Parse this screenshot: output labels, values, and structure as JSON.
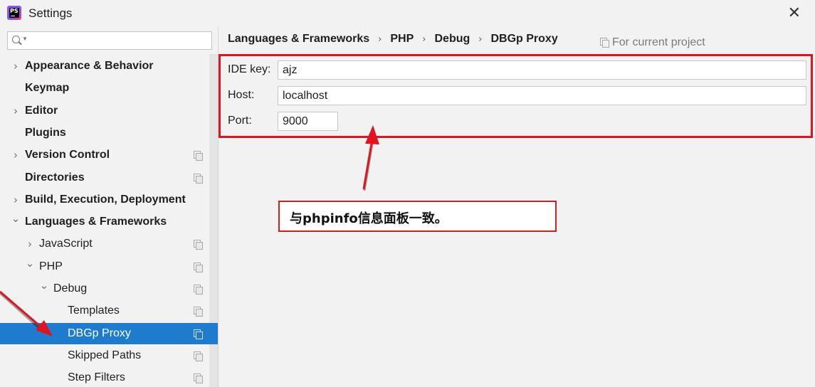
{
  "window": {
    "title": "Settings",
    "close_glyph": "✕"
  },
  "search": {
    "placeholder": "",
    "value": ""
  },
  "sidebar": {
    "items": [
      {
        "label": "Appearance & Behavior",
        "chevron": "›",
        "bold": true,
        "project_icon": false
      },
      {
        "label": "Keymap",
        "chevron": "",
        "bold": true,
        "project_icon": false
      },
      {
        "label": "Editor",
        "chevron": "›",
        "bold": true,
        "project_icon": false
      },
      {
        "label": "Plugins",
        "chevron": "",
        "bold": true,
        "project_icon": false
      },
      {
        "label": "Version Control",
        "chevron": "›",
        "bold": true,
        "project_icon": true
      },
      {
        "label": "Directories",
        "chevron": "",
        "bold": true,
        "project_icon": true
      },
      {
        "label": "Build, Execution, Deployment",
        "chevron": "›",
        "bold": true,
        "project_icon": false
      },
      {
        "label": "Languages & Frameworks",
        "chevron": "⌄",
        "bold": true,
        "project_icon": false
      },
      {
        "label": "JavaScript",
        "chevron": "›",
        "bold": false,
        "project_icon": true
      },
      {
        "label": "PHP",
        "chevron": "⌄",
        "bold": false,
        "project_icon": true
      },
      {
        "label": "Debug",
        "chevron": "⌄",
        "bold": false,
        "project_icon": true
      },
      {
        "label": "Templates",
        "chevron": "",
        "bold": false,
        "project_icon": true
      },
      {
        "label": "DBGp Proxy",
        "chevron": "",
        "bold": false,
        "project_icon": true,
        "selected": true
      },
      {
        "label": "Skipped Paths",
        "chevron": "",
        "bold": false,
        "project_icon": true
      },
      {
        "label": "Step Filters",
        "chevron": "",
        "bold": false,
        "project_icon": true
      }
    ]
  },
  "breadcrumb": {
    "items": [
      "Languages & Frameworks",
      "PHP",
      "Debug",
      "DBGp Proxy"
    ],
    "separator": "›"
  },
  "scope_label": "For current project",
  "form": {
    "ide_key_label": "IDE key:",
    "ide_key_value": "ajz",
    "host_label": "Host:",
    "host_value": "localhost",
    "port_label": "Port:",
    "port_value": "9000"
  },
  "annotation": {
    "note": "与phpinfo信息面板一致。",
    "color": "#e0141e"
  },
  "colors": {
    "selection": "#1e7bcd",
    "background": "#f2f2f2"
  }
}
